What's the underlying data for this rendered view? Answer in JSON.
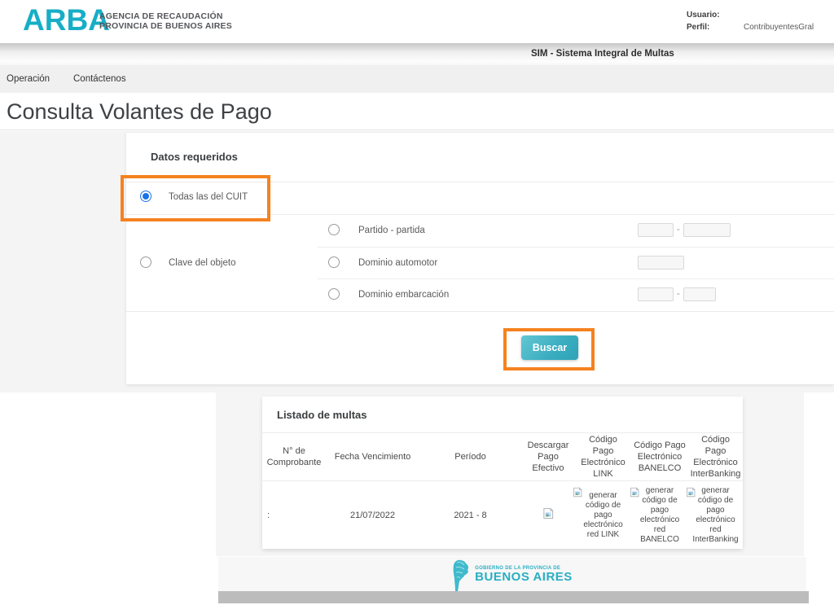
{
  "header": {
    "logo_text": "ARBA",
    "org_line1": "AGENCIA DE RECAUDACIÓN",
    "org_line2": "PROVINCIA DE BUENOS AIRES",
    "user_label": "Usuario:",
    "user_value": "",
    "profile_label": "Perfil:",
    "profile_value": "ContribuyentesGral"
  },
  "sim_bar": {
    "title": "SIM - Sistema Integral de Multas"
  },
  "nav": {
    "operacion": "Operación",
    "contactenos": "Contáctenos"
  },
  "page": {
    "title": "Consulta Volantes de Pago"
  },
  "form": {
    "section_title": "Datos requeridos",
    "radio_todas_cuit": "Todas las del CUIT",
    "radio_clave_objeto": "Clave del objeto",
    "radio_partido": "Partido - partida",
    "radio_dominio_automotor": "Dominio automotor",
    "radio_dominio_embarcacion": "Dominio embarcación",
    "separator": "-",
    "search_button": "Buscar"
  },
  "table": {
    "title": "Listado de multas",
    "columns": [
      "N° de Comprobante",
      "Fecha Vencimiento",
      "Período",
      "Descargar Pago Efectivo",
      "Código Pago Electrónico LINK",
      "Código Pago Electrónico BANELCO",
      "Código Pago Electrónico InterBanking"
    ],
    "row": {
      "comprobante": ":",
      "fecha_vencimiento": "21/07/2022",
      "periodo": "2021 - 8",
      "link_label": "generar código de pago electrónico red LINK",
      "banelco_label": "generar código de pago electrónico red BANELCO",
      "interbanking_label": "generar código de pago electrónico red InterBanking"
    }
  },
  "footer": {
    "gov_line1": "GOBIERNO DE LA PROVINCIA DE",
    "gov_line2": "BUENOS AIRES"
  },
  "colors": {
    "accent_teal": "#17aec6",
    "button_teal": "#2da3b8",
    "annotation_orange": "#f58220",
    "radio_selected_blue": "#1a73e8"
  },
  "icons": {
    "broken_image": "broken-image-icon",
    "province_map": "provincia-map-icon"
  }
}
